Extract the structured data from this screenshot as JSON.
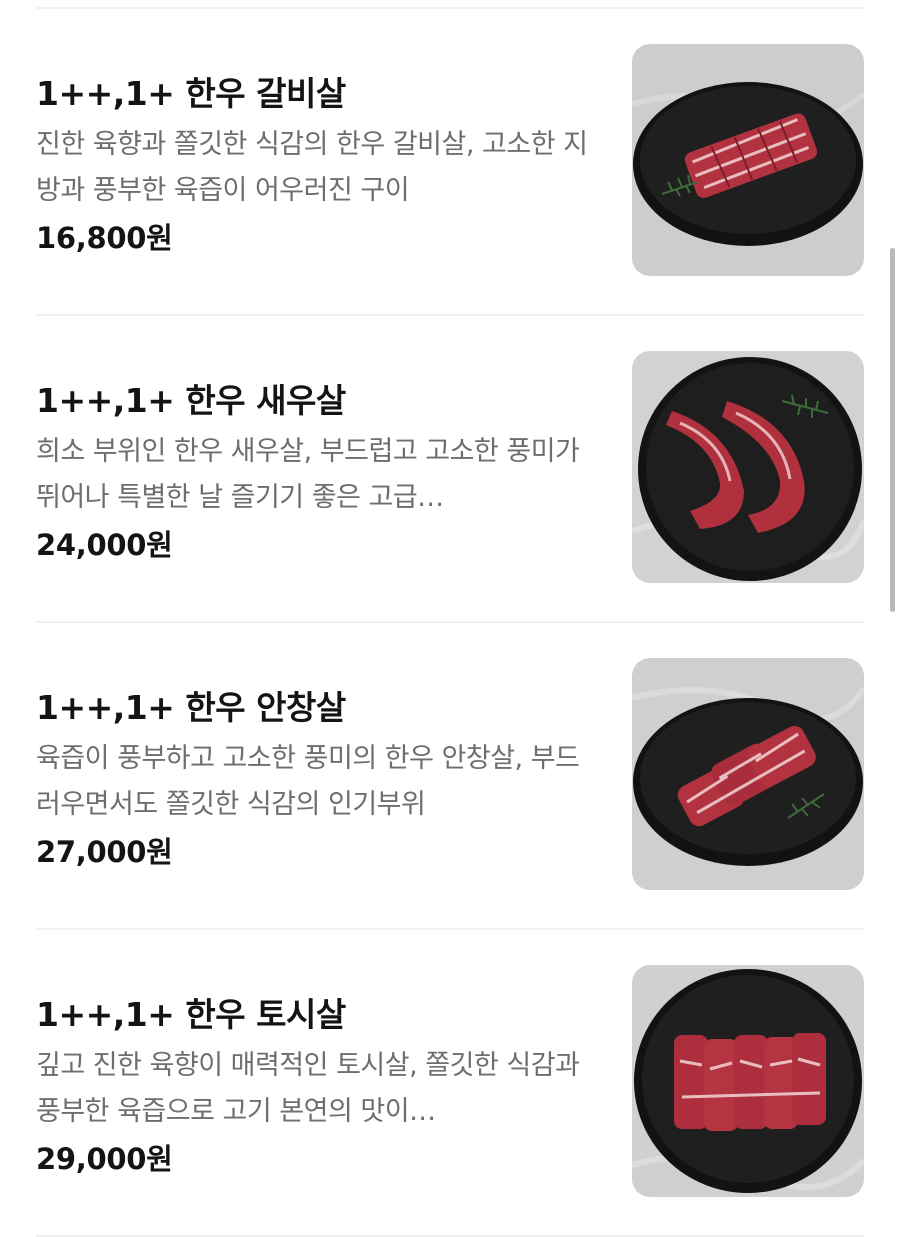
{
  "menu": {
    "items": [
      {
        "title": "1++,1+ 한우 갈비살",
        "description": "진한 육향과 쫄깃한 식감의 한우 갈비살, 고소한 지방과 풍부한 육즙이 어우러진 구이",
        "price": "16,800원",
        "image": "meat-plate-galbisal"
      },
      {
        "title": "1++,1+ 한우 새우살",
        "description": "희소 부위인 한우 새우살, 부드럽고 고소한 풍미가 뛰어나 특별한 날 즐기기 좋은 고급…",
        "price": "24,000원",
        "image": "meat-plate-saeusal"
      },
      {
        "title": "1++,1+ 한우 안창살",
        "description": "육즙이 풍부하고 고소한 풍미의 한우 안창살, 부드러우면서도 쫄깃한 식감의 인기부위",
        "price": "27,000원",
        "image": "meat-plate-anchangsal"
      },
      {
        "title": "1++,1+ 한우 토시살",
        "description": "깊고 진한 육향이 매력적인 토시살, 쫄깃한 식감과 풍부한 육즙으로 고기 본연의 맛이…",
        "price": "29,000원",
        "image": "meat-plate-tosisal"
      }
    ]
  },
  "colors": {
    "meat": "#b8323e",
    "marbling": "#f3d7d7",
    "plate": "#1c1c1c",
    "table": "#cfcfcf"
  }
}
